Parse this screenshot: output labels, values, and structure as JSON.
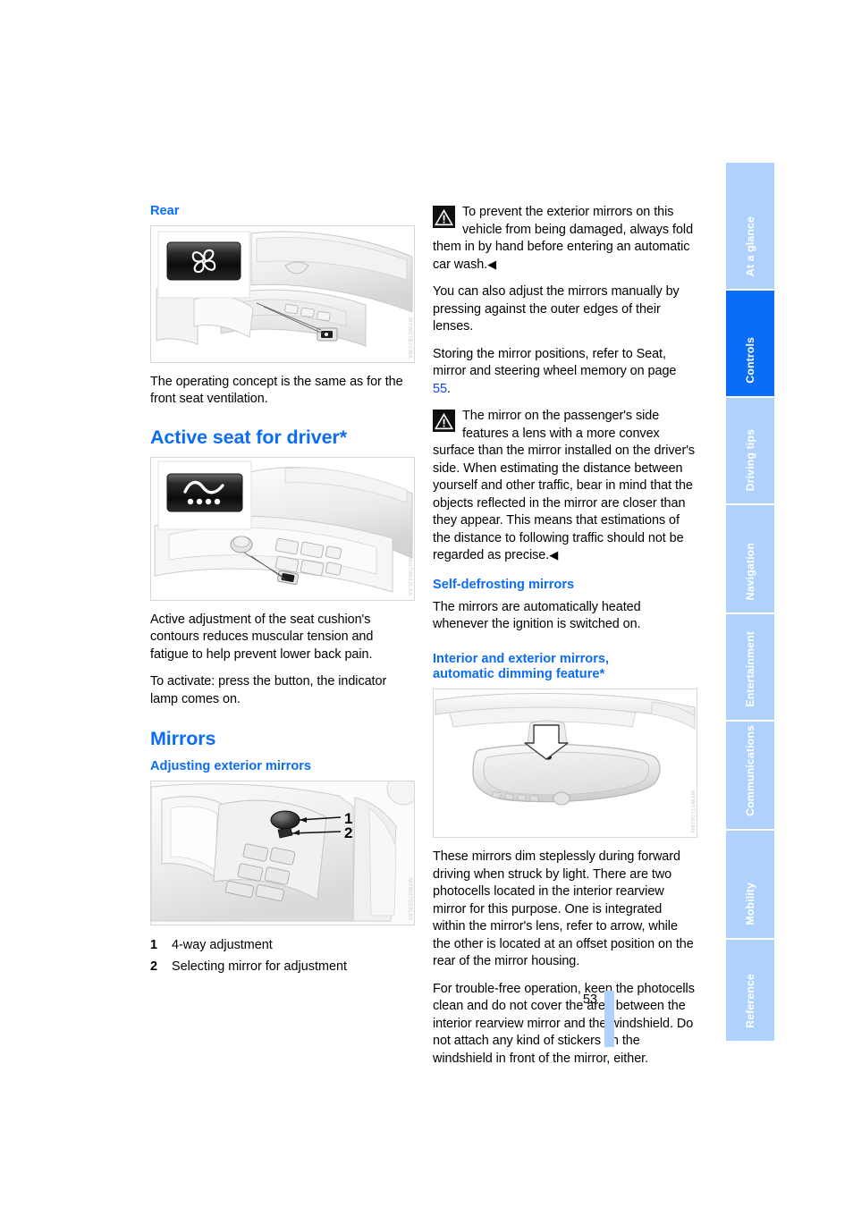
{
  "page": {
    "number": "53",
    "chapter": "Controls"
  },
  "left_column": {
    "rear_heading": "Rear",
    "rear_figure": {
      "name": "rear-seat-ventilation-figure",
      "watermark": "MYW07B7CMA",
      "button_icon": "fan-icon"
    },
    "rear_text": "The operating concept is the same as for the front seat ventilation.",
    "active_seat_heading": "Active seat for driver*",
    "active_seat_figure": {
      "name": "active-seat-button-figure",
      "watermark": "MYW07H6A2LXA",
      "button_icon": "wave-dots-icon"
    },
    "active_seat_text_1": "Active adjustment of the seat cushion's contours reduces muscular tension and fatigue to help prevent lower back pain.",
    "active_seat_text_2": "To activate: press the button, the indicator lamp comes on.",
    "mirrors_heading": "Mirrors",
    "adjusting_heading": "Adjusting exterior mirrors",
    "mirror_figure": {
      "name": "door-panel-mirror-controls-figure",
      "watermark": "MYW07C53LAY",
      "callouts": [
        "1",
        "2"
      ]
    },
    "legend": [
      {
        "num": "1",
        "text": "4-way adjustment"
      },
      {
        "num": "2",
        "text": "Selecting mirror for adjustment"
      }
    ]
  },
  "right_column": {
    "warning_1": "To prevent the exterior mirrors on this vehicle from being damaged, always fold them in by hand before entering an automatic car wash.",
    "para_1": "You can also adjust the mirrors manually by pressing against the outer edges of their lenses.",
    "para_2_before": "Storing the mirror positions, refer to Seat, mirror and steering wheel memory on page ",
    "para_2_link": "55",
    "para_2_after": ".",
    "warning_2": "The mirror on the passenger's side features a lens with a more convex surface than the mirror installed on the driver's side. When estimating the distance between yourself and other traffic, bear in mind that the objects reflected in the mirror are closer than they appear. This means that estimations of the distance to following traffic should not be regarded as precise.",
    "self_defrost_heading": "Self-defrosting mirrors",
    "self_defrost_text": "The mirrors are automatically heated whenever the ignition is switched on.",
    "auto_dim_heading_line1": "Interior and exterior mirrors,",
    "auto_dim_heading_line2": "automatic dimming feature*",
    "rearview_figure": {
      "name": "interior-rearview-mirror-figure",
      "watermark": "MYW07L0A1Ms",
      "annotation_icon": "down-arrow-icon"
    },
    "auto_dim_text_1": "These mirrors dim steplessly during forward driving when struck by light. There are two photocells located in the interior rearview mirror for this purpose. One is integrated within the mirror's lens, refer to arrow, while the other is located at an offset position on the rear of the mirror housing.",
    "auto_dim_text_2": "For trouble-free operation, keep the photocells clean and do not cover the area between the interior rearview mirror and the windshield. Do not attach any kind of stickers on the windshield in front of the mirror, either."
  },
  "sidebar": {
    "tabs": [
      {
        "label": "At a glance",
        "active": false
      },
      {
        "label": "Controls",
        "active": true
      },
      {
        "label": "Driving tips",
        "active": false
      },
      {
        "label": "Navigation",
        "active": false
      },
      {
        "label": "Entertainment",
        "active": false
      },
      {
        "label": "Communications",
        "active": false
      },
      {
        "label": "Mobility",
        "active": false
      },
      {
        "label": "Reference",
        "active": false
      }
    ]
  },
  "colors": {
    "heading_blue": "#0b6df5",
    "tab_inactive": "#aed2fd",
    "tab_active": "#0a6df7",
    "link_blue": "#0b46f5"
  }
}
